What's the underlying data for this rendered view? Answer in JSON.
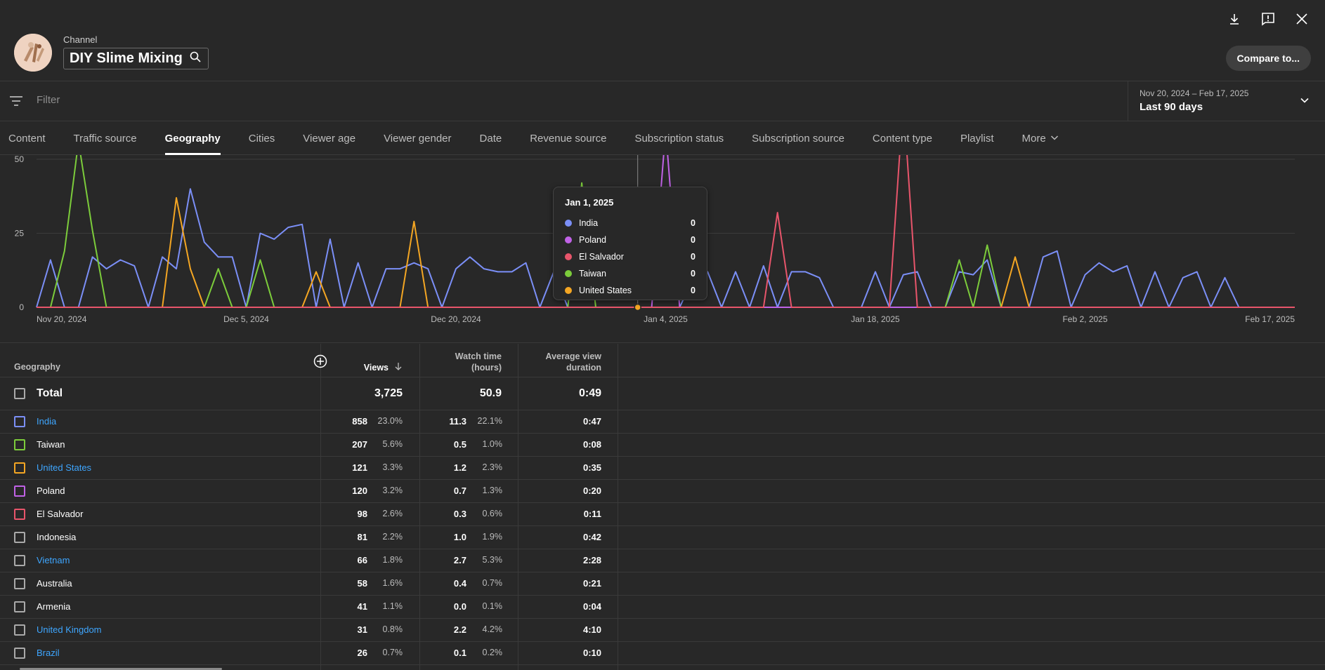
{
  "header": {
    "channel_label": "Channel",
    "channel_name": "DIY Slime Mixing",
    "compare_label": "Compare to..."
  },
  "filter": {
    "placeholder": "Filter"
  },
  "date_range": {
    "range": "Nov 20, 2024 – Feb 17, 2025",
    "label": "Last 90 days"
  },
  "tabs": [
    {
      "label": "Content"
    },
    {
      "label": "Traffic source"
    },
    {
      "label": "Geography",
      "active": true
    },
    {
      "label": "Cities"
    },
    {
      "label": "Viewer age"
    },
    {
      "label": "Viewer gender"
    },
    {
      "label": "Date"
    },
    {
      "label": "Revenue source"
    },
    {
      "label": "Subscription status"
    },
    {
      "label": "Subscription source"
    },
    {
      "label": "Content type"
    },
    {
      "label": "Playlist"
    },
    {
      "label": "More"
    }
  ],
  "chart_data": {
    "type": "line",
    "y_ticks": [
      "50",
      "25",
      "0"
    ],
    "ylim": [
      0,
      50
    ],
    "x_tick_labels": [
      "Nov 20, 2024",
      "Dec 5, 2024",
      "Dec 20, 2024",
      "Jan 4, 2025",
      "Jan 18, 2025",
      "Feb 2, 2025",
      "Feb 17, 2025"
    ],
    "grid": true,
    "series": [
      {
        "name": "India",
        "color": "#7b8ff7",
        "values": [
          0,
          16,
          0,
          0,
          17,
          13,
          16,
          14,
          0,
          17,
          13,
          40,
          22,
          17,
          17,
          0,
          25,
          23,
          27,
          28,
          0,
          23,
          0,
          15,
          0,
          13,
          13,
          15,
          13,
          0,
          13,
          17,
          13,
          12,
          12,
          15,
          0,
          12,
          0,
          0,
          0,
          0,
          0,
          0,
          0,
          0,
          0,
          10,
          12,
          0,
          12,
          0,
          14,
          0,
          12,
          12,
          10,
          0,
          0,
          0,
          12,
          0,
          11,
          12,
          0,
          0,
          12,
          11,
          16,
          0,
          0,
          0,
          17,
          19,
          0,
          11,
          15,
          12,
          14,
          0,
          12,
          0,
          10,
          12,
          0,
          10,
          0,
          0,
          0,
          0,
          0
        ]
      },
      {
        "name": "Taiwan",
        "color": "#7ccc3b",
        "values": [
          0,
          0,
          19,
          56,
          26,
          0,
          0,
          0,
          0,
          0,
          0,
          0,
          0,
          13,
          0,
          0,
          16,
          0,
          0,
          0,
          0,
          0,
          0,
          0,
          0,
          0,
          0,
          0,
          0,
          0,
          0,
          0,
          0,
          0,
          0,
          0,
          0,
          0,
          0,
          42,
          0,
          0,
          0,
          0,
          0,
          0,
          0,
          0,
          0,
          0,
          0,
          0,
          0,
          0,
          0,
          0,
          0,
          0,
          0,
          0,
          0,
          0,
          0,
          0,
          0,
          0,
          16,
          0,
          21,
          0,
          0,
          0,
          0,
          0,
          0,
          0,
          0,
          0,
          0,
          0,
          0,
          0,
          0,
          0,
          0,
          0,
          0,
          0,
          0,
          0,
          0
        ]
      },
      {
        "name": "United States",
        "color": "#f4a623",
        "values": [
          0,
          0,
          0,
          0,
          0,
          0,
          0,
          0,
          0,
          0,
          37,
          13,
          0,
          0,
          0,
          0,
          0,
          0,
          0,
          0,
          12,
          0,
          0,
          0,
          0,
          0,
          0,
          29,
          0,
          0,
          0,
          0,
          0,
          0,
          0,
          0,
          0,
          0,
          0,
          0,
          0,
          0,
          0,
          0,
          0,
          0,
          0,
          0,
          0,
          0,
          0,
          0,
          0,
          0,
          0,
          0,
          0,
          0,
          0,
          0,
          0,
          0,
          0,
          0,
          0,
          0,
          0,
          0,
          0,
          0,
          17,
          0,
          0,
          0,
          0,
          0,
          0,
          0,
          0,
          0,
          0,
          0,
          0,
          0,
          0,
          0,
          0,
          0,
          0,
          0,
          0
        ]
      },
      {
        "name": "Poland",
        "color": "#c062e6",
        "values": [
          0,
          0,
          0,
          0,
          0,
          0,
          0,
          0,
          0,
          0,
          0,
          0,
          0,
          0,
          0,
          0,
          0,
          0,
          0,
          0,
          0,
          0,
          0,
          0,
          0,
          0,
          0,
          0,
          0,
          0,
          0,
          0,
          0,
          0,
          0,
          0,
          0,
          0,
          0,
          0,
          0,
          0,
          0,
          0,
          0,
          60,
          0,
          0,
          0,
          0,
          0,
          0,
          0,
          0,
          0,
          0,
          0,
          0,
          0,
          0,
          0,
          0,
          0,
          0,
          0,
          0,
          0,
          0,
          0,
          0,
          0,
          0,
          0,
          0,
          0,
          0,
          0,
          0,
          0,
          0,
          0,
          0,
          0,
          0,
          0,
          0,
          0,
          0,
          0,
          0,
          0
        ]
      },
      {
        "name": "El Salvador",
        "color": "#e8556b",
        "values": [
          0,
          0,
          0,
          0,
          0,
          0,
          0,
          0,
          0,
          0,
          0,
          0,
          0,
          0,
          0,
          0,
          0,
          0,
          0,
          0,
          0,
          0,
          0,
          0,
          0,
          0,
          0,
          0,
          0,
          0,
          0,
          0,
          0,
          0,
          0,
          0,
          0,
          0,
          0,
          0,
          0,
          0,
          0,
          0,
          0,
          0,
          0,
          0,
          0,
          0,
          0,
          0,
          0,
          32,
          0,
          0,
          0,
          0,
          0,
          0,
          0,
          0,
          70,
          0,
          0,
          0,
          0,
          0,
          0,
          0,
          0,
          0,
          0,
          0,
          0,
          0,
          0,
          0,
          0,
          0,
          0,
          0,
          0,
          0,
          0,
          0,
          0,
          0,
          0,
          0,
          0
        ]
      }
    ]
  },
  "tooltip": {
    "date": "Jan 1, 2025",
    "rows": [
      {
        "name": "India",
        "value": "0",
        "color": "#7b8ff7"
      },
      {
        "name": "Poland",
        "value": "0",
        "color": "#c062e6"
      },
      {
        "name": "El Salvador",
        "value": "0",
        "color": "#e8556b"
      },
      {
        "name": "Taiwan",
        "value": "0",
        "color": "#7ccc3b"
      },
      {
        "name": "United States",
        "value": "0",
        "color": "#f4a623"
      }
    ]
  },
  "table": {
    "headers": {
      "geography": "Geography",
      "views": "Views",
      "watch_time_1": "Watch time",
      "watch_time_2": "(hours)",
      "avd_1": "Average view",
      "avd_2": "duration"
    },
    "total": {
      "label": "Total",
      "views": "3,725",
      "watch": "50.9",
      "avd": "0:49"
    },
    "rows": [
      {
        "name": "India",
        "link": true,
        "color": "#7b8ff7",
        "views": "858",
        "vpct": "23.0%",
        "watch": "11.3",
        "wpct": "22.1%",
        "avd": "0:47"
      },
      {
        "name": "Taiwan",
        "link": false,
        "color": "#7ccc3b",
        "views": "207",
        "vpct": "5.6%",
        "watch": "0.5",
        "wpct": "1.0%",
        "avd": "0:08"
      },
      {
        "name": "United States",
        "link": true,
        "color": "#f4a623",
        "views": "121",
        "vpct": "3.3%",
        "watch": "1.2",
        "wpct": "2.3%",
        "avd": "0:35"
      },
      {
        "name": "Poland",
        "link": false,
        "color": "#c062e6",
        "views": "120",
        "vpct": "3.2%",
        "watch": "0.7",
        "wpct": "1.3%",
        "avd": "0:20"
      },
      {
        "name": "El Salvador",
        "link": false,
        "color": "#e8556b",
        "views": "98",
        "vpct": "2.6%",
        "watch": "0.3",
        "wpct": "0.6%",
        "avd": "0:11"
      },
      {
        "name": "Indonesia",
        "link": false,
        "color": "#aaaaaa",
        "views": "81",
        "vpct": "2.2%",
        "watch": "1.0",
        "wpct": "1.9%",
        "avd": "0:42"
      },
      {
        "name": "Vietnam",
        "link": true,
        "color": "#aaaaaa",
        "views": "66",
        "vpct": "1.8%",
        "watch": "2.7",
        "wpct": "5.3%",
        "avd": "2:28"
      },
      {
        "name": "Australia",
        "link": false,
        "color": "#aaaaaa",
        "views": "58",
        "vpct": "1.6%",
        "watch": "0.4",
        "wpct": "0.7%",
        "avd": "0:21"
      },
      {
        "name": "Armenia",
        "link": false,
        "color": "#aaaaaa",
        "views": "41",
        "vpct": "1.1%",
        "watch": "0.0",
        "wpct": "0.1%",
        "avd": "0:04"
      },
      {
        "name": "United Kingdom",
        "link": true,
        "color": "#aaaaaa",
        "views": "31",
        "vpct": "0.8%",
        "watch": "2.2",
        "wpct": "4.2%",
        "avd": "4:10"
      },
      {
        "name": "Brazil",
        "link": true,
        "color": "#aaaaaa",
        "views": "26",
        "vpct": "0.7%",
        "watch": "0.1",
        "wpct": "0.2%",
        "avd": "0:10"
      }
    ]
  }
}
